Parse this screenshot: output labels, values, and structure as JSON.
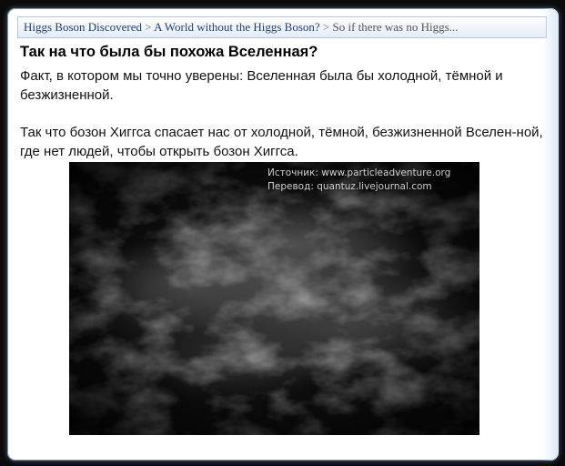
{
  "breadcrumb": {
    "item1": "Higgs Boson Discovered",
    "sep1": " > ",
    "item2": "A World without the Higgs Boson?",
    "sep2": " > ",
    "current": "So if there was no Higgs..."
  },
  "heading": "Так на что была бы похожа Вселенная?",
  "paragraph1": "Факт, в котором мы точно уверены: Вселенная была бы холодной, тёмной и безжизненной.",
  "paragraph2": "Так что бозон Хиггса спасает нас от холодной, тёмной, безжизненной Вселен-ной, где нет людей, чтобы открыть бозон Хиггса.",
  "image": {
    "credit_source": "Источник: www.particleadventure.org",
    "credit_translation": "Перевод: quantuz.livejournal.com"
  }
}
